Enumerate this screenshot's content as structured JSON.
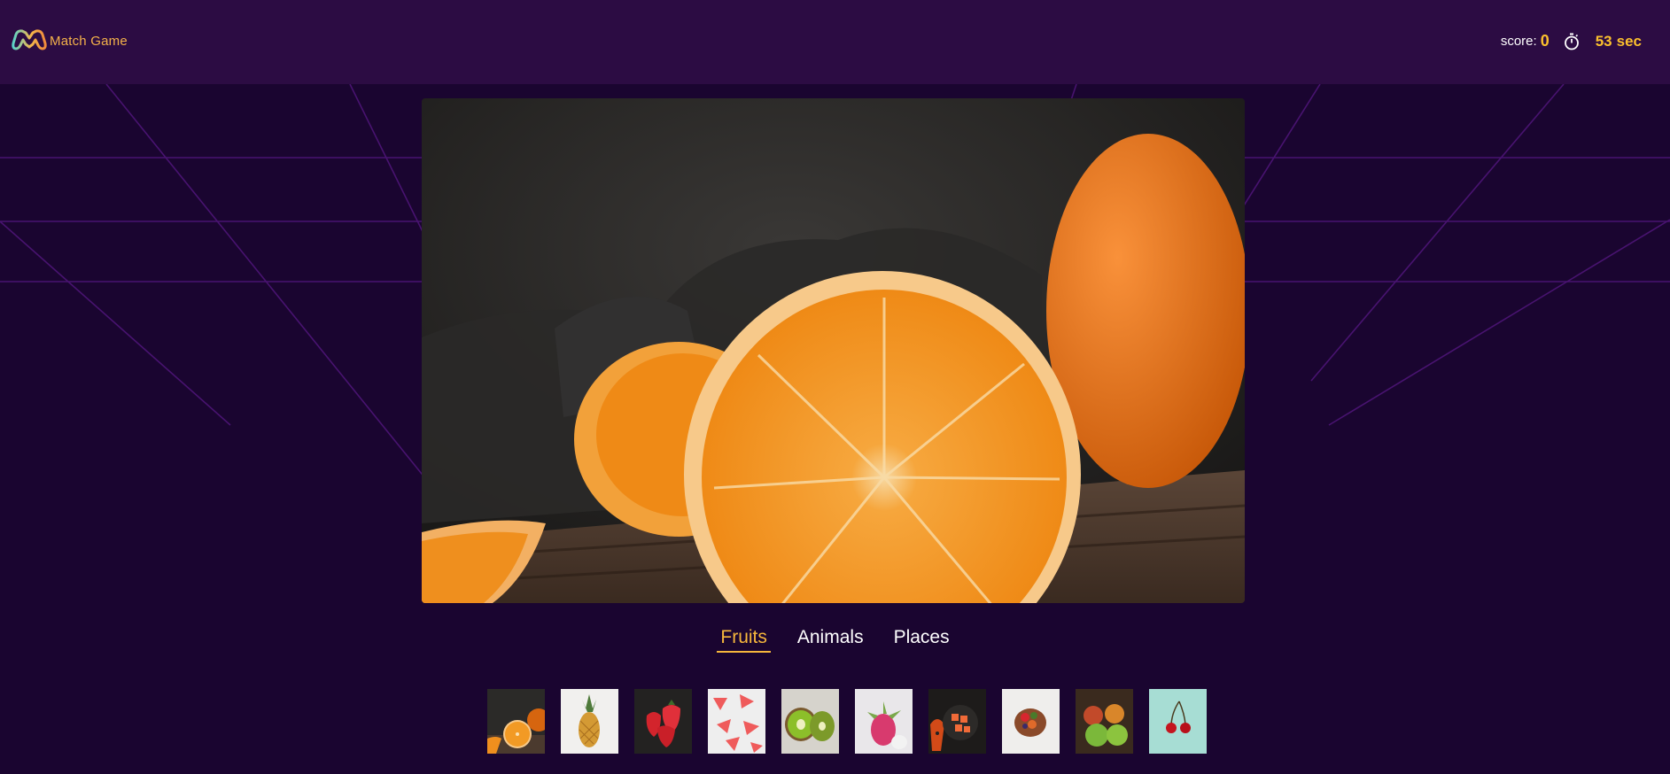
{
  "app": {
    "title": "Match Game"
  },
  "header": {
    "logo_icon": "gamepad-m-logo-icon",
    "score_label": "score:",
    "score_value": "0",
    "timer_icon": "stopwatch-icon",
    "timer_value": "53",
    "timer_unit": "sec"
  },
  "main_image": {
    "subject": "orange"
  },
  "tabs": [
    {
      "label": "Fruits",
      "active": true
    },
    {
      "label": "Animals",
      "active": false
    },
    {
      "label": "Places",
      "active": false
    }
  ],
  "thumbnails": [
    {
      "subject": "orange"
    },
    {
      "subject": "pineapple"
    },
    {
      "subject": "strawberry"
    },
    {
      "subject": "watermelon"
    },
    {
      "subject": "kiwi"
    },
    {
      "subject": "dragon fruit"
    },
    {
      "subject": "papaya"
    },
    {
      "subject": "fruit bowl"
    },
    {
      "subject": "apple"
    },
    {
      "subject": "cherry"
    }
  ],
  "colors": {
    "background": "#1a0530",
    "navbar": "#2c0c43",
    "accent": "#fbc02d",
    "active_tab": "#f6b73c",
    "grid_lines": "#5a1a86"
  }
}
